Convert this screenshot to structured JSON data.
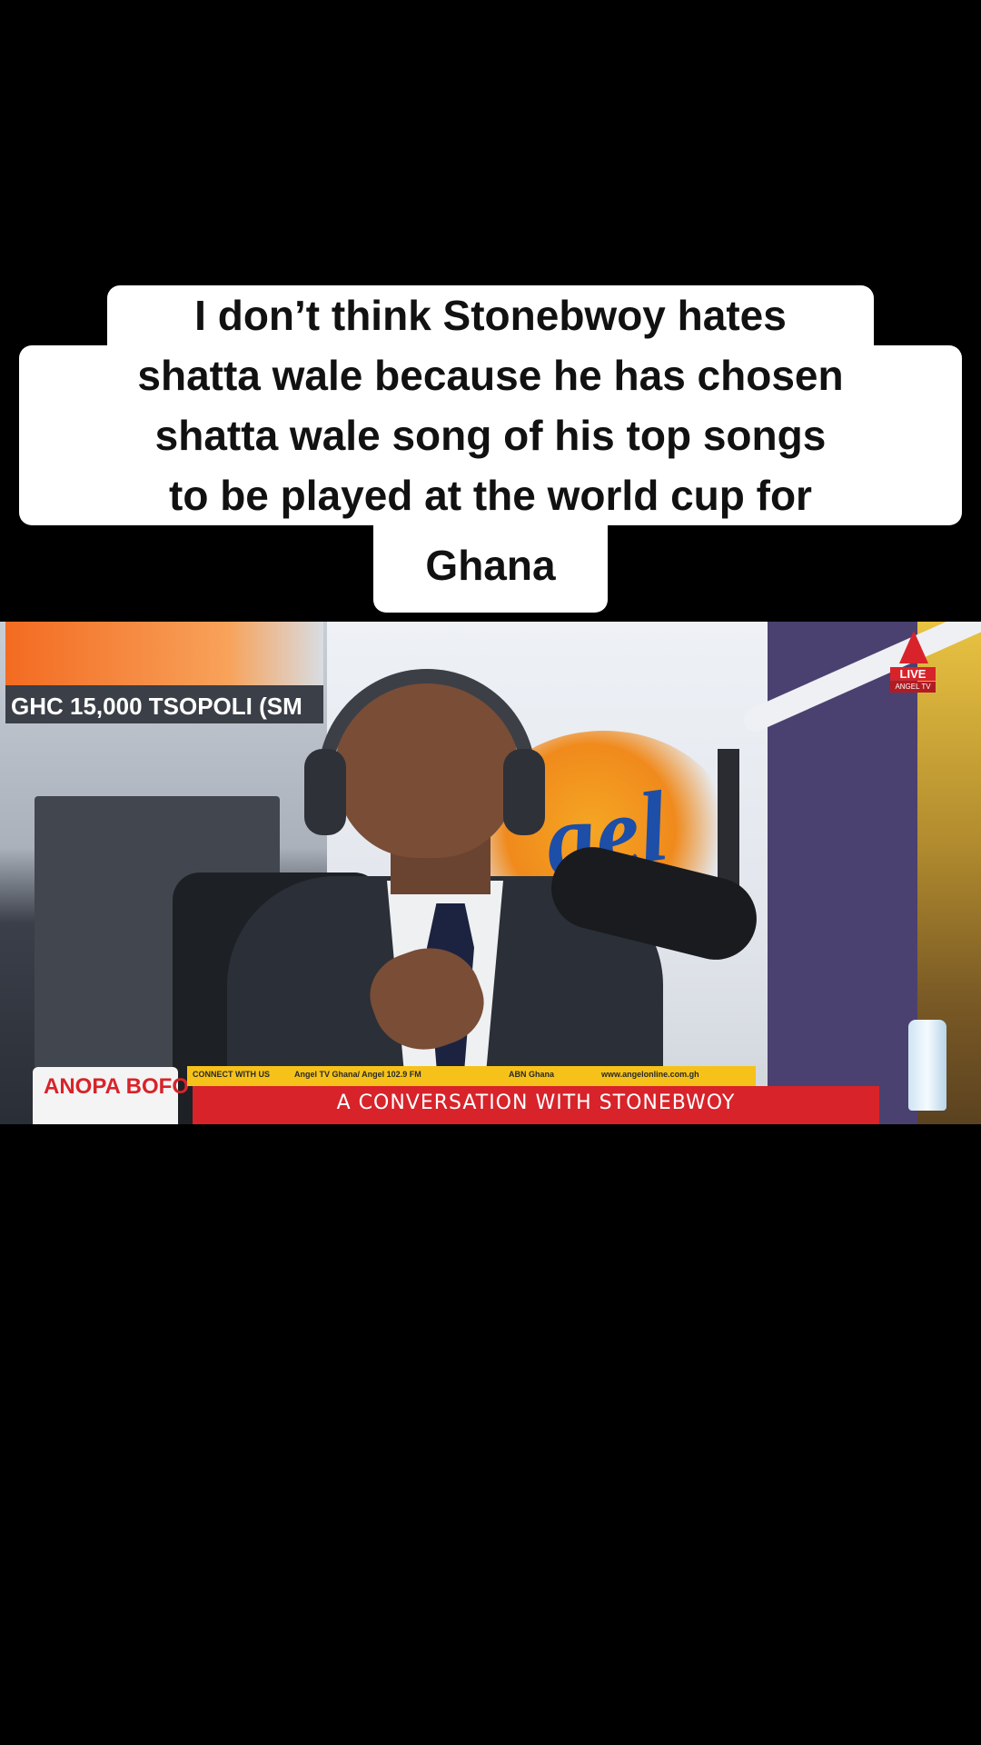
{
  "caption": {
    "lines": [
      "I don’t think Stonebwoy hates",
      "shatta wale because he has chosen",
      "shatta wale song of his top songs",
      "to be played at the world cup for",
      "Ghana"
    ]
  },
  "video": {
    "ticker_text": "GHC 15,000 TSOPOLI (SM",
    "live_badge": {
      "label": "LIVE",
      "channel": "ANGEL TV"
    },
    "studio_logo_text": "gel",
    "lower_third": {
      "connect_label": "CONNECT WITH US",
      "social_handles": "Angel TV Ghana/ Angel 102.9 FM",
      "youtube_handle": "ABN Ghana",
      "website": "www.angelonline.com.gh",
      "show_title": "A CONVERSATION WITH STONEBWOY"
    },
    "sponsor_text": "ANOPA BOFO"
  },
  "colors": {
    "caption_bg": "#ffffff",
    "caption_text": "#111111",
    "brand_red": "#d8232a",
    "brand_yellow": "#f6c21a",
    "page_bg": "#000000"
  }
}
